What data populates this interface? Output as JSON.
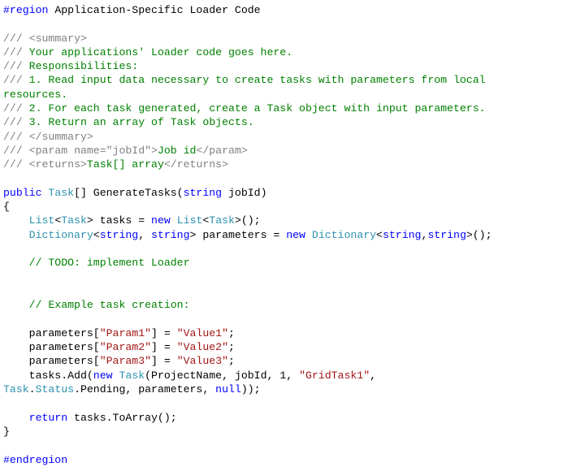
{
  "colors": {
    "plain": "#000000",
    "keyword": "#0000ff",
    "comment": "#008000",
    "doc_tag": "#808080",
    "type": "#2b91af",
    "string": "#a31515"
  },
  "code": {
    "lines": [
      [
        [
          "k",
          "#region"
        ],
        [
          "p",
          " Application-Specific Loader Code"
        ]
      ],
      [],
      [
        [
          "g",
          "///"
        ],
        [
          "c",
          " "
        ],
        [
          "g",
          "<summary>"
        ]
      ],
      [
        [
          "g",
          "///"
        ],
        [
          "c",
          " Your applications' Loader code goes here."
        ]
      ],
      [
        [
          "g",
          "///"
        ],
        [
          "c",
          " Responsibilities:"
        ]
      ],
      [
        [
          "g",
          "///"
        ],
        [
          "c",
          " 1. Read input data necessary to create tasks with parameters from local"
        ]
      ],
      [
        [
          "c",
          "resources."
        ]
      ],
      [
        [
          "g",
          "///"
        ],
        [
          "c",
          " 2. For each task generated, create a Task object with input parameters."
        ]
      ],
      [
        [
          "g",
          "///"
        ],
        [
          "c",
          " 3. Return an array of Task objects."
        ]
      ],
      [
        [
          "g",
          "///"
        ],
        [
          "c",
          " "
        ],
        [
          "g",
          "</summary>"
        ]
      ],
      [
        [
          "g",
          "///"
        ],
        [
          "c",
          " "
        ],
        [
          "g",
          "<param name=\"jobId\">"
        ],
        [
          "c",
          "Job id"
        ],
        [
          "g",
          "</param>"
        ]
      ],
      [
        [
          "g",
          "///"
        ],
        [
          "c",
          " "
        ],
        [
          "g",
          "<returns>"
        ],
        [
          "c",
          "Task[] array"
        ],
        [
          "g",
          "</returns>"
        ]
      ],
      [],
      [
        [
          "k",
          "public"
        ],
        [
          "p",
          " "
        ],
        [
          "t",
          "Task"
        ],
        [
          "p",
          "[] GenerateTasks("
        ],
        [
          "k",
          "string"
        ],
        [
          "p",
          " jobId)"
        ]
      ],
      [
        [
          "p",
          "{"
        ]
      ],
      [
        [
          "p",
          "    "
        ],
        [
          "t",
          "List"
        ],
        [
          "p",
          "<"
        ],
        [
          "t",
          "Task"
        ],
        [
          "p",
          "> tasks = "
        ],
        [
          "k",
          "new"
        ],
        [
          "p",
          " "
        ],
        [
          "t",
          "List"
        ],
        [
          "p",
          "<"
        ],
        [
          "t",
          "Task"
        ],
        [
          "p",
          ">();"
        ]
      ],
      [
        [
          "p",
          "    "
        ],
        [
          "t",
          "Dictionary"
        ],
        [
          "p",
          "<"
        ],
        [
          "k",
          "string"
        ],
        [
          "p",
          ", "
        ],
        [
          "k",
          "string"
        ],
        [
          "p",
          "> parameters = "
        ],
        [
          "k",
          "new"
        ],
        [
          "p",
          " "
        ],
        [
          "t",
          "Dictionary"
        ],
        [
          "p",
          "<"
        ],
        [
          "k",
          "string"
        ],
        [
          "p",
          ","
        ],
        [
          "k",
          "string"
        ],
        [
          "p",
          ">();"
        ]
      ],
      [],
      [
        [
          "p",
          "    "
        ],
        [
          "c",
          "// TODO: implement Loader"
        ]
      ],
      [],
      [],
      [
        [
          "p",
          "    "
        ],
        [
          "c",
          "// Example task creation:"
        ]
      ],
      [],
      [
        [
          "p",
          "    parameters["
        ],
        [
          "s",
          "\"Param1\""
        ],
        [
          "p",
          "] = "
        ],
        [
          "s",
          "\"Value1\""
        ],
        [
          "p",
          ";"
        ]
      ],
      [
        [
          "p",
          "    parameters["
        ],
        [
          "s",
          "\"Param2\""
        ],
        [
          "p",
          "] = "
        ],
        [
          "s",
          "\"Value2\""
        ],
        [
          "p",
          ";"
        ]
      ],
      [
        [
          "p",
          "    parameters["
        ],
        [
          "s",
          "\"Param3\""
        ],
        [
          "p",
          "] = "
        ],
        [
          "s",
          "\"Value3\""
        ],
        [
          "p",
          ";"
        ]
      ],
      [
        [
          "p",
          "    tasks.Add("
        ],
        [
          "k",
          "new"
        ],
        [
          "p",
          " "
        ],
        [
          "t",
          "Task"
        ],
        [
          "p",
          "(ProjectName, jobId, 1, "
        ],
        [
          "s",
          "\"GridTask1\""
        ],
        [
          "p",
          ","
        ]
      ],
      [
        [
          "t",
          "Task"
        ],
        [
          "p",
          "."
        ],
        [
          "t",
          "Status"
        ],
        [
          "p",
          ".Pending, parameters, "
        ],
        [
          "k",
          "null"
        ],
        [
          "p",
          "));"
        ]
      ],
      [],
      [
        [
          "p",
          "    "
        ],
        [
          "k",
          "return"
        ],
        [
          "p",
          " tasks.ToArray();"
        ]
      ],
      [
        [
          "p",
          "}"
        ]
      ],
      [],
      [
        [
          "k",
          "#endregion"
        ]
      ]
    ]
  }
}
